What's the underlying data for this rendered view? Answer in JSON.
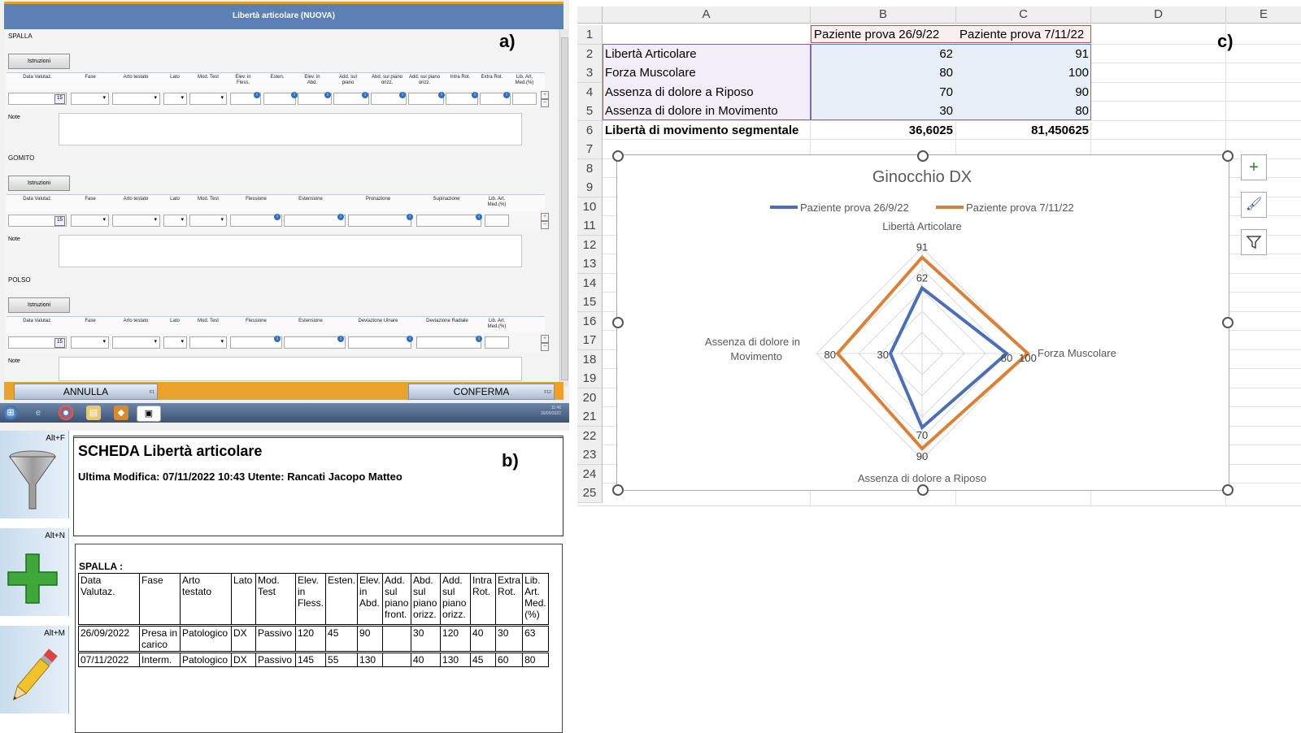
{
  "panel_labels": {
    "a": "a)",
    "b": "b)",
    "c": "c)"
  },
  "panel_a": {
    "title": "Libertà articolare (NUOVA)",
    "istruzioni_label": "Istruzioni",
    "note_label": "Note",
    "sections": {
      "spalla": {
        "name": "SPALLA",
        "headers": [
          "Data Valutaz.",
          "Fase",
          "Arto testato",
          "Lato",
          "Mod. Test",
          "Elev. in Fless.",
          "Esten.",
          "Elev. in Abd.",
          "Add. sul piano",
          "Abd. sul piano orizz.",
          "Add. sul piano orizz.",
          "Intra Rot.",
          "Extra Rot.",
          "Lib. Art. Med.(%)"
        ]
      },
      "gomito": {
        "name": "GOMITO",
        "headers": [
          "Data Valutaz.",
          "Fase",
          "Arto testato",
          "Lato",
          "Mod. Test",
          "Flessione",
          "Estensione",
          "Pronazione",
          "Supinazione",
          "Lib. Art. Med.(%)"
        ]
      },
      "polso": {
        "name": "POLSO",
        "headers": [
          "Data Valutaz.",
          "Fase",
          "Arto testato",
          "Lato",
          "Mod. Test",
          "Flessione",
          "Estensione",
          "Deviazione Ulnare",
          "Deviazione Radiale",
          "Lib. Art. Med.(%)"
        ]
      }
    },
    "buttons": {
      "annulla": "ANNULLA",
      "annulla_key": "F1",
      "conferma": "CONFERMA",
      "conferma_key": "F12"
    },
    "taskbar": {
      "time": "11:46",
      "date": "30/09/2022"
    }
  },
  "panel_b": {
    "side_buttons": [
      {
        "key": "Alt+F",
        "icon": "funnel-icon"
      },
      {
        "key": "Alt+N",
        "icon": "plus-icon"
      },
      {
        "key": "Alt+M",
        "icon": "pencil-icon"
      }
    ],
    "title": "SCHEDA Libertà articolare",
    "subtitle": "Ultima Modifica: 07/11/2022 10:43 Utente: Rancati Jacopo Matteo",
    "section": "SPALLA :",
    "columns": [
      "Data Valutaz.",
      "Fase",
      "Arto testato",
      "Lato",
      "Mod. Test",
      "Elev. in Fless.",
      "Esten.",
      "Elev. in Abd.",
      "Add. sul piano front.",
      "Abd. sul piano orizz.",
      "Add. sul piano orizz.",
      "Intra Rot.",
      "Extra Rot.",
      "Lib. Art. Med. (%)"
    ],
    "rows": [
      [
        "26/09/2022",
        "Presa in carico",
        "Patologico",
        "DX",
        "Passivo",
        "120",
        "45",
        "90",
        "",
        "30",
        "120",
        "40",
        "30",
        "63"
      ],
      [
        "07/11/2022",
        "Interm.",
        "Patologico",
        "DX",
        "Passivo",
        "145",
        "55",
        "130",
        "",
        "40",
        "130",
        "45",
        "60",
        "80"
      ]
    ]
  },
  "panel_c": {
    "columns": [
      "A",
      "B",
      "C",
      "D",
      "E"
    ],
    "rows": [
      "1",
      "2",
      "3",
      "4",
      "5",
      "6",
      "7",
      "8",
      "9",
      "10",
      "11",
      "12",
      "13",
      "14",
      "15",
      "16",
      "17",
      "18",
      "19",
      "20",
      "21",
      "22",
      "23",
      "24",
      "25"
    ],
    "cells": {
      "b1": "Paziente prova 26/9/22",
      "c1": "Paziente prova 7/11/22",
      "a2": "Libertà Articolare",
      "b2": "62",
      "c2": "91",
      "a3": "Forza Muscolare",
      "b3": "80",
      "c3": "100",
      "a4": "Assenza di dolore a Riposo",
      "b4": "70",
      "c4": "90",
      "a5": "Assenza di dolore in Movimento",
      "b5": "30",
      "c5": "80",
      "a6": "Libertà di movimento segmentale",
      "b6": "36,6025",
      "c6": "81,450625"
    },
    "chart_data": {
      "type": "radar",
      "title": "Ginocchio DX",
      "categories": [
        "Libertà Articolare",
        "Forza Muscolare",
        "Assenza di dolore a Riposo",
        "Assenza di dolore in Movimento"
      ],
      "series": [
        {
          "name": "Paziente prova 26/9/22",
          "values": [
            62,
            80,
            70,
            30
          ],
          "color": "#4a6fb5"
        },
        {
          "name": "Paziente prova 7/11/22",
          "values": [
            91,
            100,
            90,
            80
          ],
          "color": "#d98138"
        }
      ],
      "rlim": [
        0,
        100
      ],
      "gridlines": [
        20,
        40,
        60,
        80,
        100
      ],
      "legend": "top"
    }
  }
}
